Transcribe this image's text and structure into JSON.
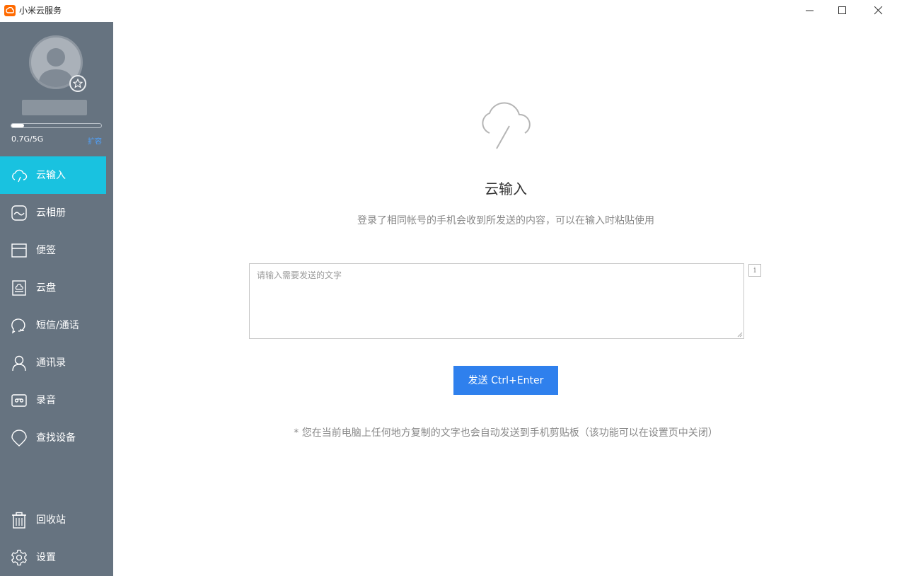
{
  "window": {
    "title": "小米云服务"
  },
  "sidebar": {
    "storage_text": "0.7G/5G",
    "storage_fraction": 0.14,
    "expand_label": "扩容",
    "nav": [
      {
        "label": "云输入",
        "icon": "cloud-input-icon"
      },
      {
        "label": "云相册",
        "icon": "gallery-icon"
      },
      {
        "label": "便签",
        "icon": "notes-icon"
      },
      {
        "label": "云盘",
        "icon": "cloud-drive-icon"
      },
      {
        "label": "短信/通话",
        "icon": "sms-icon"
      },
      {
        "label": "通讯录",
        "icon": "contacts-icon"
      },
      {
        "label": "录音",
        "icon": "recorder-icon"
      },
      {
        "label": "查找设备",
        "icon": "find-device-icon"
      }
    ],
    "bottom": [
      {
        "label": "回收站",
        "icon": "trash-icon"
      },
      {
        "label": "设置",
        "icon": "gear-icon"
      }
    ]
  },
  "main": {
    "title": "云输入",
    "subtitle": "登录了相同帐号的手机会收到所发送的内容，可以在输入时粘贴使用",
    "input_placeholder": "请输入需要发送的文字",
    "info_glyph": "i",
    "send_label": "发送 Ctrl+Enter",
    "footnote": "* 您在当前电脑上任何地方复制的文字也会自动发送到手机剪贴板（该功能可以在设置页中关闭）"
  },
  "colors": {
    "sidebar_bg": "#667380",
    "active_nav": "#19c2e0",
    "primary_button": "#2f80ed",
    "link": "#4fa3ff"
  }
}
